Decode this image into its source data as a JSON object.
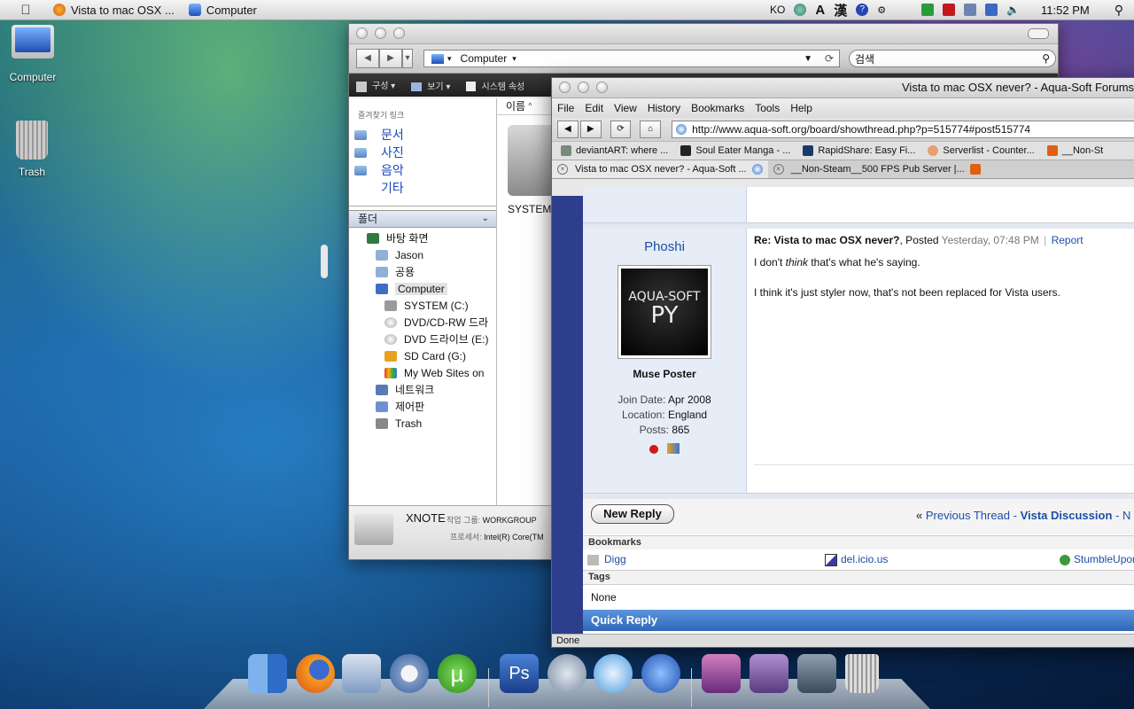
{
  "menubar": {
    "app1": "Vista to mac OSX ...",
    "app2": "Computer",
    "lang": "KO",
    "time": "11:52 PM"
  },
  "desktop": {
    "computer": "Computer",
    "trash": "Trash"
  },
  "finder": {
    "path": "Computer",
    "search_placeholder": "검색",
    "cmd": [
      "구성",
      "보기",
      "시스템 속성"
    ],
    "favorites_title": "즐겨찾기 링크",
    "favorites": [
      "문서",
      "사진",
      "음악",
      "기타"
    ],
    "folders_header": "폴더",
    "tree": [
      "바탕 화면",
      "Jason",
      "공용",
      "Computer",
      "SYSTEM (C:)",
      "DVD/CD-RW 드라",
      "DVD 드라이브 (E:)",
      "SD Card (G:)",
      "My Web Sites on",
      "네트워크",
      "제어판",
      "Trash"
    ],
    "col_name": "이름",
    "drive_label": "SYSTEM",
    "details_name": "XNOTE",
    "details_group_label": "작업 그룹:",
    "details_group": "WORKGROUP",
    "details_cpu_label": "프로세서:",
    "details_cpu": "Intel(R) Core(TM"
  },
  "firefox": {
    "title": "Vista to mac OSX never? - Aqua-Soft Forums",
    "menu": [
      "File",
      "Edit",
      "View",
      "History",
      "Bookmarks",
      "Tools",
      "Help"
    ],
    "url": "http://www.aqua-soft.org/board/showthread.php?p=515774#post515774",
    "bookmarks": [
      "deviantART: where ...",
      "Soul Eater Manga - ...",
      "RapidShare: Easy Fi...",
      "Serverlist - Counter...",
      "__Non-St"
    ],
    "tabs": [
      "Vista to mac OSX never? - Aqua-Soft ...",
      "__Non-Steam__500 FPS Pub Server |..."
    ],
    "status": "Done"
  },
  "post": {
    "username": "Phoshi",
    "rank": "Muse Poster",
    "avatar_text1": "AQUA-SOFT",
    "avatar_text2": "PY",
    "join_label": "Join Date:",
    "join": "Apr 2008",
    "location_label": "Location:",
    "location": "England",
    "posts_label": "Posts:",
    "posts": "865",
    "title": "Re: Vista to mac OSX never?",
    "posted_label": ", Posted",
    "posted": "Yesterday, 07:48 PM",
    "report": "Report",
    "line1_a": "I don't ",
    "line1_b": "think",
    "line1_c": " that's what he's saying.",
    "line2": "I think it's just styler now, that's not been replaced for Vista users."
  },
  "thread": {
    "new_reply": "New Reply",
    "prev_quote": "«",
    "prev": "Previous Thread",
    "sep": " - ",
    "forum": "Vista Discussion",
    "next": "N",
    "bookmarks_header": "Bookmarks",
    "bm": [
      "Digg",
      "del.icio.us",
      "StumbleUpon"
    ],
    "tags_header": "Tags",
    "tags": "None",
    "quick_reply": "Quick Reply"
  },
  "colors": {
    "link": "#1b4fa8",
    "quick_reply_bg": "#3c78c8",
    "forum_strip": "#2d3f8c"
  }
}
